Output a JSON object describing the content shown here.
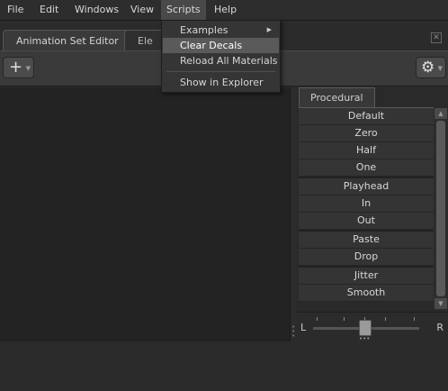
{
  "menubar": {
    "items": [
      {
        "label": "File"
      },
      {
        "label": "Edit"
      },
      {
        "label": "Windows"
      },
      {
        "label": "View"
      },
      {
        "label": "Scripts",
        "active": true
      },
      {
        "label": "Help"
      }
    ]
  },
  "tabs": [
    {
      "label": "Animation Set Editor",
      "active": true
    },
    {
      "label": "Ele"
    }
  ],
  "toolbar": {
    "add_icon": "plus-icon",
    "settings_icon": "gear-icon"
  },
  "scripts_menu": {
    "items": [
      {
        "label": "Examples",
        "submenu": true
      },
      {
        "label": "Clear Decals",
        "highlighted": true
      },
      {
        "label": "Reload All Materials"
      },
      {
        "label": "Show in Explorer"
      }
    ]
  },
  "right_panel": {
    "tab_label": "Procedural",
    "items": [
      {
        "label": "Default"
      },
      {
        "label": "Zero"
      },
      {
        "label": "Half"
      },
      {
        "label": "One"
      },
      {
        "label": "Playhead"
      },
      {
        "label": "In"
      },
      {
        "label": "Out"
      },
      {
        "label": "Paste"
      },
      {
        "label": "Drop"
      },
      {
        "label": "Jitter"
      },
      {
        "label": "Smooth"
      }
    ],
    "slider": {
      "left_label": "L",
      "right_label": "R",
      "value": 0.5
    }
  }
}
